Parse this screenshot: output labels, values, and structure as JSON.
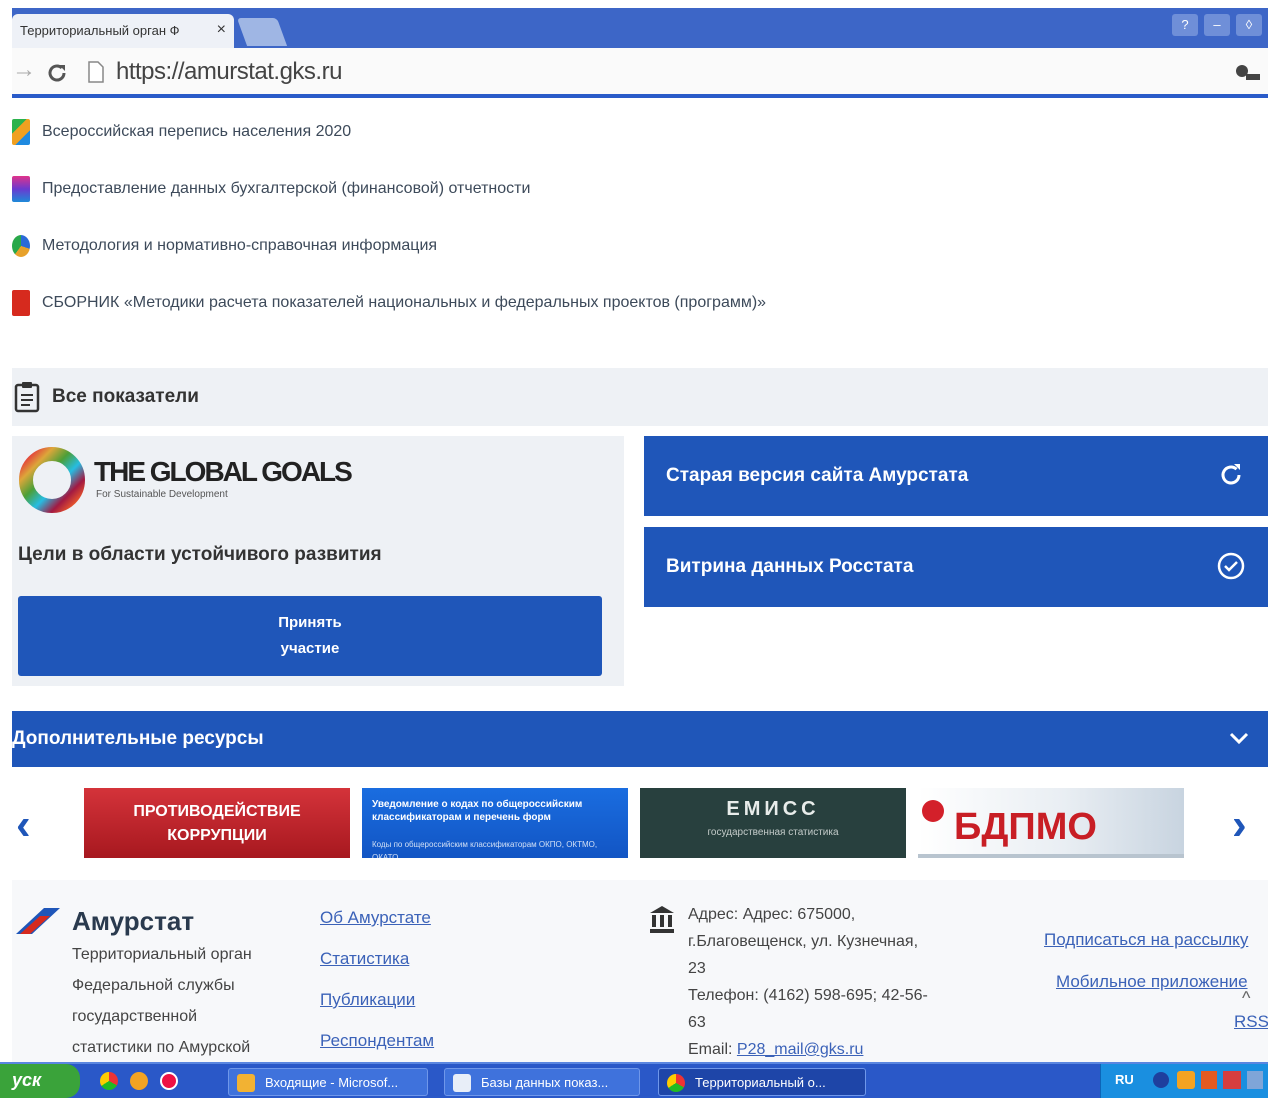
{
  "browser": {
    "tab_title": "Территориальный орган Ф",
    "tab_close": "×",
    "url": "https://amurstat.gks.ru",
    "window_controls": [
      "?",
      "–",
      "◊"
    ]
  },
  "links": [
    {
      "label": "Всероссийская перепись населения 2020",
      "icon": "census-icon"
    },
    {
      "label": "Предоставление данных бухгалтерской (финансовой) отчетности",
      "icon": "reporting-icon"
    },
    {
      "label": "Методология и нормативно-справочная информация",
      "icon": "methodology-icon"
    },
    {
      "label": "СБОРНИК «Методики расчета показателей национальных и федеральных проектов (программ)»",
      "icon": "collection-icon"
    }
  ],
  "all_indicators": {
    "label": "Все показатели",
    "icon": "clipboard-icon"
  },
  "global_goals": {
    "logo_title": "THE GLOBAL GOALS",
    "logo_subtitle": "For Sustainable Development",
    "description": "Цели в области устойчивого развития",
    "button_label": "Принять\nучастие"
  },
  "side_buttons": [
    {
      "label": "Старая версия сайта Амурстата",
      "icon": "refresh-icon"
    },
    {
      "label": "Витрина данных Росстата",
      "icon": "check-circle-icon"
    }
  ],
  "resources": {
    "label": "Дополнительные ресурсы",
    "toggle_icon": "chevron-down-icon",
    "prev": "‹",
    "next": "›",
    "banners": [
      {
        "line1": "ПРОТИВОДЕЙСТВИЕ",
        "line2": "КОРРУПЦИИ"
      },
      {
        "line1": "Уведомление о кодах по общероссийским",
        "line2": "классификаторам и перечень форм",
        "line3": "Коды по общероссийским классификаторам ОКПО, ОКТМО, ОКАТО"
      },
      {
        "line1": "ЕМИСС",
        "line2": "государственная статистика"
      },
      {
        "line1": "БДПМО"
      }
    ]
  },
  "footer": {
    "brand": "Амурстат",
    "brand_desc": [
      "Территориальный орган",
      "Федеральной службы",
      "государственной",
      "статистики по Амурской"
    ],
    "nav": [
      "Об Амурстате",
      "Статистика",
      "Публикации",
      "Респондентам"
    ],
    "address_lines": [
      "Адрес: Адрес: 675000,",
      "г.Благовещенск, ул. Кузнечная,",
      "23",
      "Телефон: (4162) 598-695; 42-56-",
      "63"
    ],
    "email_label": "Email: ",
    "email": "P28_mail@gks.ru",
    "subscribe": "Подписаться на рассылку",
    "mobile": "Мобильное приложение",
    "rss": "RSS",
    "up": "^"
  },
  "taskbar": {
    "start": "уск",
    "tasks": [
      "Входящие - Microsof...",
      "Базы данных показ...",
      "Территориальный о..."
    ],
    "lang": "RU"
  }
}
